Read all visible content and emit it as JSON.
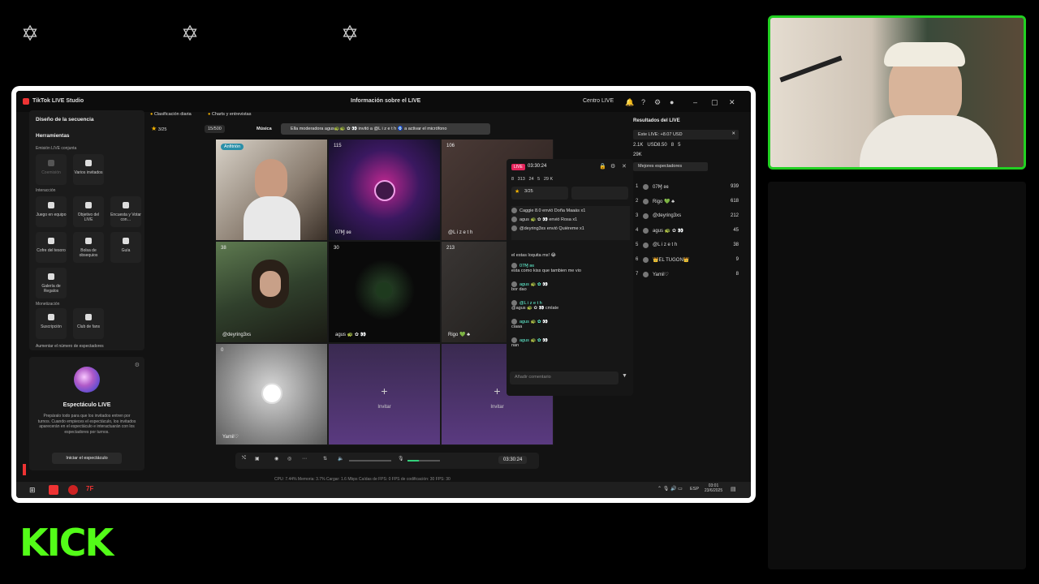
{
  "overlay": {
    "brand": "KICK",
    "colors": {
      "kick_green": "#53fc18",
      "webcam_border": "#22d022"
    }
  },
  "app": {
    "title": "TikTok LIVE Studio",
    "center_title": "Información sobre el LIVE",
    "centro_live": "Centro LIVE"
  },
  "left_panel": {
    "section_design": "Diseño de la secuencia",
    "tools_heading": "Herramientas",
    "joint_stream": "Emisión LIVE conjunta",
    "tools_joint": [
      "Coemisión",
      "Varios invitados"
    ],
    "interaction": "Interacción",
    "tools_interaction": [
      "Juego en equipo",
      "Objetivo del LIVE",
      "Encuesta y Votar con…",
      "Cofre del tesoro",
      "Bolsa de obsequios",
      "Guía",
      "Galería de Regalos"
    ],
    "monetization": "Monetización",
    "tools_monetization": [
      "Suscripción",
      "Club de fans"
    ],
    "grow_viewers": "Aumentar el número de espectadores"
  },
  "spectacle": {
    "title": "Espectáculo LIVE",
    "desc": "Prepáralo todo para que los invitados entren por turnos. Cuando empieces el espectáculo, los invitados aparecerán en el espectáculo e interactuarán con los espectadores por turnos.",
    "button": "Iniciar el espectáculo"
  },
  "toolbar2": {
    "ranking": "Clasificación diaria",
    "charts": "Charts y entrevistas",
    "stars": "3/25",
    "progress": "15/500",
    "music": "Música",
    "toast": "Ella moderadora agus🐢🐢 ✿ 👀 invitó a @L i z e t h 🧿 a activar el micrófono"
  },
  "grid": {
    "host_badge": "Anfitrión",
    "cells": [
      {
        "top": "",
        "label": ""
      },
      {
        "top": "115",
        "label": "07Ɱ ʚɞ"
      },
      {
        "top": "106",
        "label": "@L i z e t h"
      },
      {
        "top": "38",
        "label": "@deyring3xs"
      },
      {
        "top": "30",
        "label": "agus 🐢 ✿ 👀"
      },
      {
        "top": "213",
        "label": "Rigo 💚 ♣"
      },
      {
        "top": "0",
        "label": "Yamil♡"
      }
    ],
    "invite_label": "Invitar"
  },
  "chat": {
    "live_badge": "LIVE",
    "timer": "03:30:24",
    "stats": [
      "8",
      "313",
      "24",
      "5",
      "29 K"
    ],
    "goal": "3/25",
    "gifts": [
      "Caggie 8.0 envió Doña Maaás x1",
      "agus 🐢 ✿ 👀 envió Rosa x1",
      "@deyring3xs envió Quiéreme x1"
    ],
    "messages": [
      {
        "user": "",
        "text": "el estas loquita ms! 😂"
      },
      {
        "user": "07Ɱ ʚɞ",
        "text": "esta como kiss que tambien me vio"
      },
      {
        "user": "agus 🐢 ✿ 👀",
        "text": "bor dao"
      },
      {
        "user": "@L i z e t h",
        "text": "@agus 🐢 ✿ 👀 cmlate"
      },
      {
        "user": "agus 🐢 ✿ 👀",
        "text": "ciaaa"
      },
      {
        "user": "agus 🐢 ✿ 👀",
        "text": "nan"
      }
    ],
    "input_placeholder": "Añadir comentario"
  },
  "results": {
    "title": "Resultados del LIVE",
    "estelive": "Este LIVE: +8.07 USD",
    "stats": [
      "2.1K",
      "USD8.50",
      "8",
      "5"
    ],
    "likes": "29K",
    "tab": "Mejores espectadores",
    "viewers": [
      {
        "rank": "1",
        "name": "07Ɱ ʚɞ",
        "score": "939"
      },
      {
        "rank": "2",
        "name": "Rigo 💚 ♣",
        "score": "618"
      },
      {
        "rank": "3",
        "name": "@deyring3xs",
        "score": "212"
      },
      {
        "rank": "4",
        "name": "agus 🐢 ✿ 👀",
        "score": "45"
      },
      {
        "rank": "5",
        "name": "@L i z e t h",
        "score": "38"
      },
      {
        "rank": "6",
        "name": "👑EL TUGON👑",
        "score": "9"
      },
      {
        "rank": "7",
        "name": "Yamil♡",
        "score": "8"
      }
    ]
  },
  "controls": {
    "timer": "03:30:24"
  },
  "status_bar": "CPU: 7.44%   Memoria: 3.7%   Cargar: 1.6 Mbps   Caídas de FPS: 0   FPS de codificación: 30   FPS: 30",
  "taskbar": {
    "lang": "ESP",
    "time": "03:01",
    "date": "23/6/2025"
  }
}
